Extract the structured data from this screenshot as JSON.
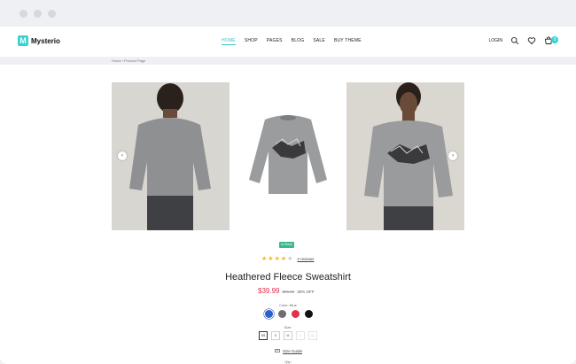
{
  "brand": {
    "logo_letter": "M",
    "name": "Mysterio",
    "accent": "#34d3d3"
  },
  "nav": {
    "items": [
      {
        "label": "HOME",
        "active": true
      },
      {
        "label": "SHOP",
        "active": false
      },
      {
        "label": "PAGES",
        "active": false
      },
      {
        "label": "BLOG",
        "active": false
      },
      {
        "label": "SALE",
        "active": false
      },
      {
        "label": "BUY THEME",
        "active": false
      }
    ]
  },
  "header_right": {
    "login": "LOGIN",
    "cart_count": "0",
    "icons": [
      "search-icon",
      "heart-icon",
      "cart-icon"
    ]
  },
  "breadcrumb": "Home / Product Page",
  "gallery": {
    "images": [
      "model-back-view",
      "product-flat-view",
      "model-front-view"
    ],
    "prev_icon": "chevron-left-icon",
    "next_icon": "chevron-right-icon"
  },
  "product": {
    "badge": "In Stock",
    "rating": 4,
    "rating_max": 5,
    "reviews": "2 reviews",
    "title": "Heathered Fleece Sweatshirt",
    "price": "$39.99",
    "old_price": "$55.00",
    "discount": "30% OFF",
    "color_label": "Color: Blue",
    "colors": [
      {
        "name": "blue",
        "hex": "#2d5fc9",
        "selected": true
      },
      {
        "name": "gray",
        "hex": "#6e6e6e",
        "selected": false
      },
      {
        "name": "red",
        "hex": "#e0314f",
        "selected": false
      },
      {
        "name": "black",
        "hex": "#111111",
        "selected": false
      }
    ],
    "size_label": "Size:",
    "sizes": [
      {
        "label": "XS",
        "state": "selected"
      },
      {
        "label": "S",
        "state": "normal"
      },
      {
        "label": "M",
        "state": "normal"
      },
      {
        "label": "L",
        "state": "disabled"
      },
      {
        "label": "XL",
        "state": "disabled"
      }
    ],
    "size_guide": "Size Guide",
    "qty_label": "Qty:"
  }
}
